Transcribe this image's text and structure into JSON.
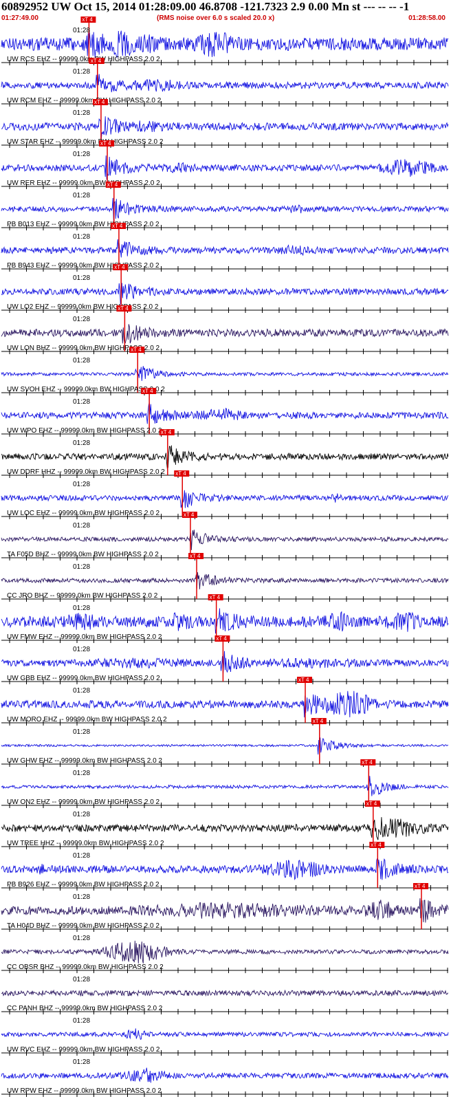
{
  "header": {
    "title": "60892952 UW Oct 15, 2014 01:28:09.00   46.8708 -121.7323  2.9 0.00 Mn st --- -- --  -1",
    "start_time": "01:27:49.00",
    "rms_note": "(RMS noise over 6.0 s scaled 20.0 x)",
    "end_time": "01:28:58.00"
  },
  "colors": {
    "blue": "#1010e0",
    "purple": "#2a1660",
    "black": "#000000",
    "pick": "#e00000",
    "axis": "#000000"
  },
  "chart_data": {
    "type": "line",
    "time_range": [
      "01:27:49.00",
      "01:28:58.00"
    ],
    "tick_label": "01:28",
    "pick_label": "xT 4",
    "trace_label_suffix": " -- 99999.0km BW  HIGHPASS  2.0  2",
    "traces": [
      {
        "station": "UW RCS EHZ",
        "color": "blue",
        "pick_x": 0.196,
        "amp": 0.6,
        "bursts": [
          [
            0.3,
            0.8,
            0.03
          ],
          [
            0.48,
            0.8,
            0.03
          ],
          [
            0.26,
            0.5,
            0.06
          ]
        ]
      },
      {
        "station": "UW RCM EHZ",
        "color": "blue",
        "pick_x": 0.215,
        "amp": 0.3,
        "bursts": [
          [
            0.35,
            0.3,
            0.05
          ]
        ]
      },
      {
        "station": "UW STAR EHZ",
        "color": "blue",
        "pick_x": 0.223,
        "amp": 0.35,
        "bursts": [
          [
            0.33,
            0.2,
            0.04
          ]
        ]
      },
      {
        "station": "UW RER EHZ",
        "color": "blue",
        "pick_x": 0.237,
        "amp": 0.3,
        "bursts": [
          [
            0.91,
            0.6,
            0.05
          ],
          [
            0.4,
            0.2,
            0.04
          ]
        ]
      },
      {
        "station": "PB B013 EHZ",
        "color": "blue",
        "pick_x": 0.252,
        "amp": 0.25,
        "bursts": [
          [
            0.66,
            0.2,
            0.02
          ]
        ]
      },
      {
        "station": "PB B943 EHZ",
        "color": "blue",
        "pick_x": 0.263,
        "amp": 0.3,
        "bursts": [
          [
            0.66,
            0.25,
            0.03
          ]
        ]
      },
      {
        "station": "UW LO2 EHZ",
        "color": "blue",
        "pick_x": 0.268,
        "amp": 0.3,
        "bursts": []
      },
      {
        "station": "UW LON BHZ",
        "color": "purple",
        "pick_x": 0.276,
        "amp": 0.35,
        "bursts": []
      },
      {
        "station": "UW SVOH EHZ",
        "color": "blue",
        "pick_x": 0.305,
        "amp": 0.15,
        "bursts": []
      },
      {
        "station": "UW WPO EHZ",
        "color": "blue",
        "pick_x": 0.331,
        "amp": 0.3,
        "bursts": [
          [
            0.49,
            0.4,
            0.04
          ]
        ]
      },
      {
        "station": "UW DDRF HHZ",
        "color": "black",
        "pick_x": 0.372,
        "amp": 0.3,
        "bursts": []
      },
      {
        "station": "UW LOC EHZ",
        "color": "blue",
        "pick_x": 0.405,
        "amp": 0.25,
        "bursts": [
          [
            0.75,
            0.25,
            0.01
          ]
        ]
      },
      {
        "station": "TA F05D BHZ",
        "color": "purple",
        "pick_x": 0.423,
        "amp": 0.2,
        "bursts": []
      },
      {
        "station": "CC JRO BHZ",
        "color": "purple",
        "pick_x": 0.437,
        "amp": 0.2,
        "bursts": []
      },
      {
        "station": "UW FMW EHZ",
        "color": "blue",
        "pick_x": 0.481,
        "amp": 0.5,
        "bursts": [
          [
            0.18,
            0.4,
            0.03
          ],
          [
            0.4,
            0.5,
            0.02
          ],
          [
            0.75,
            0.5,
            0.03
          ],
          [
            0.9,
            0.5,
            0.03
          ]
        ]
      },
      {
        "station": "UW GBB EHZ",
        "color": "blue",
        "pick_x": 0.496,
        "amp": 0.3,
        "bursts": [
          [
            0.3,
            0.2,
            0.1
          ],
          [
            0.7,
            0.2,
            0.1
          ]
        ]
      },
      {
        "station": "UW MORO EHZ",
        "color": "blue",
        "pick_x": 0.68,
        "amp": 0.35,
        "bursts": [
          [
            0.78,
            0.9,
            0.05
          ]
        ]
      },
      {
        "station": "UW GHW EHZ",
        "color": "blue",
        "pick_x": 0.712,
        "amp": 0.1,
        "bursts": []
      },
      {
        "station": "UW ON2 EHZ",
        "color": "blue",
        "pick_x": 0.822,
        "amp": 0.15,
        "bursts": [
          [
            0.85,
            0.15,
            0.01
          ]
        ]
      },
      {
        "station": "UW TREE HHZ",
        "color": "black",
        "pick_x": 0.832,
        "amp": 0.35,
        "bursts": [
          [
            0.9,
            0.4,
            0.05
          ]
        ]
      },
      {
        "station": "PB B926 EHZ",
        "color": "blue",
        "pick_x": 0.842,
        "amp": 0.35,
        "bursts": [
          [
            0.66,
            0.6,
            0.06
          ],
          [
            0.09,
            0.5,
            0.005
          ]
        ]
      },
      {
        "station": "TA H04D BHZ",
        "color": "purple",
        "pick_x": 0.94,
        "amp": 0.4,
        "bursts": [
          [
            0.5,
            0.4,
            0.15
          ],
          [
            0.85,
            0.6,
            0.03
          ]
        ]
      },
      {
        "station": "CC OBSR BHZ",
        "color": "purple",
        "pick_x": null,
        "amp": 0.2,
        "bursts": [
          [
            0.3,
            1.0,
            0.06
          ]
        ]
      },
      {
        "station": "CC PANH BHZ",
        "color": "purple",
        "pick_x": null,
        "amp": 0.25,
        "bursts": []
      },
      {
        "station": "UW RVC EHZ",
        "color": "blue",
        "pick_x": null,
        "amp": 0.2,
        "bursts": [
          [
            0.3,
            0.4,
            0.02
          ]
        ]
      },
      {
        "station": "UW RPW EHZ",
        "color": "blue",
        "pick_x": null,
        "amp": 0.25,
        "bursts": [
          [
            0.32,
            0.5,
            0.04
          ]
        ]
      }
    ]
  }
}
